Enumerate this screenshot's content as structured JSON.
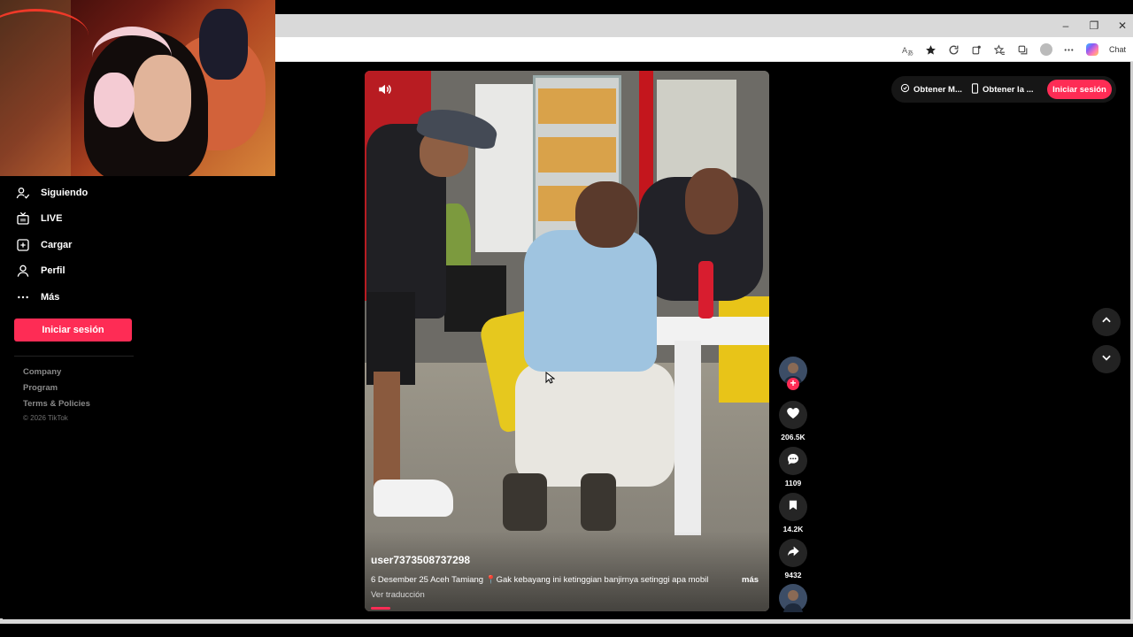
{
  "browser": {
    "chat_label": "Chat",
    "controls": {
      "minimize": "–",
      "restore": "❐",
      "close": "✕"
    }
  },
  "sidebar": {
    "items": [
      {
        "label": "Siguiendo",
        "icon": "following-icon"
      },
      {
        "label": "LIVE",
        "icon": "live-tv-icon"
      },
      {
        "label": "Cargar",
        "icon": "upload-icon"
      },
      {
        "label": "Perfil",
        "icon": "profile-icon"
      },
      {
        "label": "Más",
        "icon": "more-dots-icon"
      }
    ],
    "login_label": "Iniciar sesión",
    "footer": {
      "links": [
        "Company",
        "Program",
        "Terms & Policies"
      ],
      "copyright": "© 2026 TikTok"
    }
  },
  "topbar": {
    "get_coins_label": "Obtener M...",
    "get_app_label": "Obtener la ...",
    "login_label": "Iniciar sesión"
  },
  "video": {
    "username": "user7373508737298",
    "description": "6 Desember 25 Aceh Tamiang 📍Gak kebayang ini ketinggian banjirnya setinggi apa mobil",
    "more_label": "más",
    "translate_label": "Ver traducción",
    "progress_fraction": 0.05
  },
  "actions": {
    "likes": "206.5K",
    "comments": "1109",
    "saves": "14.2K",
    "shares": "9432"
  },
  "colors": {
    "brand": "#fe2c55",
    "background": "#000000",
    "rail_button": "#252525",
    "muted_text": "#8a8a8a"
  }
}
